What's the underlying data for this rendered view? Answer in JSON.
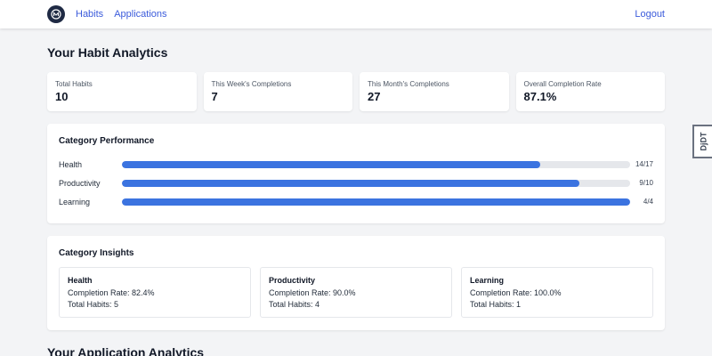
{
  "nav": {
    "logo_icon": "app-logo-icon",
    "links": [
      "Habits",
      "Applications"
    ],
    "logout": "Logout"
  },
  "page_title": "Your Habit Analytics",
  "stats": [
    {
      "label": "Total Habits",
      "value": "10"
    },
    {
      "label": "This Week's Completions",
      "value": "7"
    },
    {
      "label": "This Month's Completions",
      "value": "27"
    },
    {
      "label": "Overall Completion Rate",
      "value": "87.1%"
    }
  ],
  "category_performance": {
    "title": "Category Performance",
    "rows": [
      {
        "name": "Health",
        "count": "14/17",
        "fraction": 0.8235
      },
      {
        "name": "Productivity",
        "count": "9/10",
        "fraction": 0.9
      },
      {
        "name": "Learning",
        "count": "4/4",
        "fraction": 1.0
      }
    ]
  },
  "category_insights": {
    "title": "Category Insights",
    "items": [
      {
        "name": "Health",
        "rate": "Completion Rate: 82.4%",
        "total": "Total Habits: 5"
      },
      {
        "name": "Productivity",
        "rate": "Completion Rate: 90.0%",
        "total": "Total Habits: 4"
      },
      {
        "name": "Learning",
        "rate": "Completion Rate: 100.0%",
        "total": "Total Habits: 1"
      }
    ]
  },
  "application_title": "Your Application Analytics",
  "debug_toolbar_label": "DjDT",
  "colors": {
    "accent": "#3b73e0",
    "link": "#3b5bdb"
  }
}
